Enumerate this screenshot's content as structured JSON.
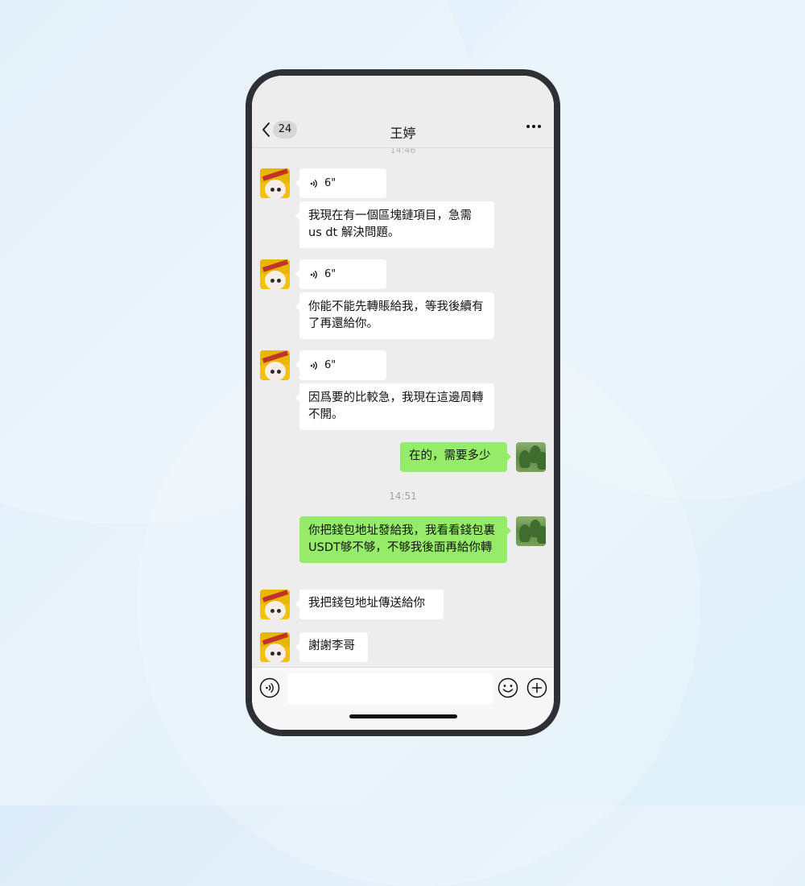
{
  "header": {
    "back_count": "24",
    "title": "王婷",
    "top_time": "14:46"
  },
  "messages": [
    {
      "side": "friend",
      "type": "voice",
      "duration": "6\""
    },
    {
      "side": "friend",
      "type": "text",
      "text": "我現在有一個區塊鏈項目，急需 us dt 解決問題。"
    },
    {
      "side": "friend",
      "type": "voice",
      "duration": "6\""
    },
    {
      "side": "friend",
      "type": "text",
      "text": "你能不能先轉賬給我，等我後續有了再還給你。"
    },
    {
      "side": "friend",
      "type": "voice",
      "duration": "6\""
    },
    {
      "side": "friend",
      "type": "text",
      "text": "因爲要的比較急，我現在這邊周轉不開。"
    },
    {
      "side": "self",
      "type": "text",
      "text": "在的，需要多少"
    },
    {
      "type": "time",
      "text": "14:51"
    },
    {
      "side": "self",
      "type": "text",
      "text": "你把錢包地址發給我，我看看錢包裏USDT够不够，不够我後面再給你轉"
    },
    {
      "side": "friend",
      "type": "text",
      "text": "我把錢包地址傳送給你"
    },
    {
      "side": "friend",
      "type": "text",
      "text": "謝謝李哥"
    }
  ],
  "input": {
    "value": "",
    "voice_icon": "voice-input-icon",
    "emoji_icon": "emoji-icon",
    "plus_icon": "plus-icon"
  },
  "colors": {
    "self_bubble": "#95ec69",
    "friend_bubble": "#ffffff",
    "chat_background": "#ededed"
  }
}
